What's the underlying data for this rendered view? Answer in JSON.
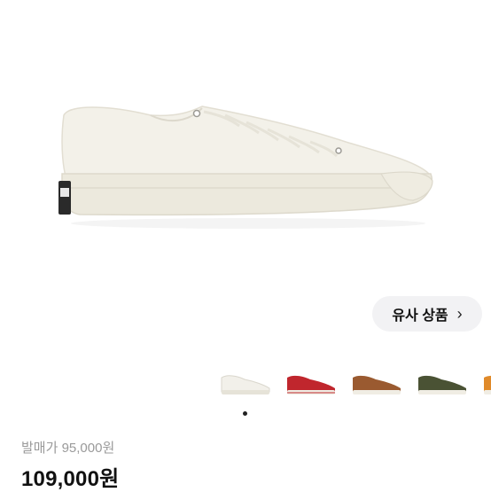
{
  "similar_button": {
    "label": "유사 상품",
    "chevron": "›"
  },
  "thumbnails": [
    {
      "name": "white",
      "color": "#f2f0ea",
      "selected": true
    },
    {
      "name": "red",
      "color": "#c0262d"
    },
    {
      "name": "brown",
      "color": "#9a5a30"
    },
    {
      "name": "olive",
      "color": "#4a5234"
    },
    {
      "name": "orange",
      "color": "#e08a2a"
    }
  ],
  "price_info": {
    "release_price": "발매가 95,000원",
    "current_price": "109,000원"
  },
  "colors": {
    "shoe": "#f1efe6",
    "sole": "#ebe8dc",
    "button_bg": "#f2f2f4",
    "muted_text": "#9a9a9a"
  }
}
